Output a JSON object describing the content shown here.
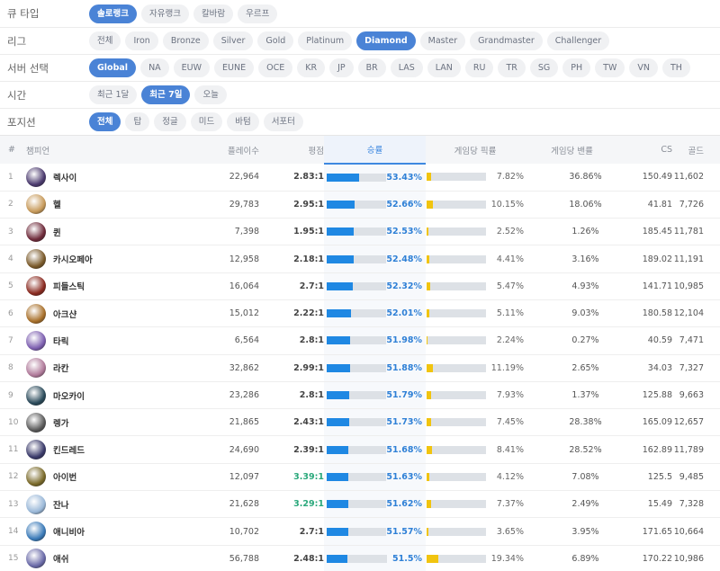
{
  "filters": [
    {
      "label": "큐 타입",
      "options": [
        "솔로랭크",
        "자유랭크",
        "칼바람",
        "우르프"
      ],
      "active": 0
    },
    {
      "label": "리그",
      "options": [
        "전체",
        "Iron",
        "Bronze",
        "Silver",
        "Gold",
        "Platinum",
        "Diamond",
        "Master",
        "Grandmaster",
        "Challenger"
      ],
      "active": 6
    },
    {
      "label": "서버 선택",
      "options": [
        "Global",
        "NA",
        "EUW",
        "EUNE",
        "OCE",
        "KR",
        "JP",
        "BR",
        "LAS",
        "LAN",
        "RU",
        "TR",
        "SG",
        "PH",
        "TW",
        "VN",
        "TH"
      ],
      "active": 0
    },
    {
      "label": "시간",
      "options": [
        "최근 1달",
        "최근 7일",
        "오늘"
      ],
      "active": 1
    },
    {
      "label": "포지션",
      "options": [
        "전체",
        "탑",
        "정글",
        "미드",
        "바텀",
        "서포터"
      ],
      "active": 0
    }
  ],
  "table": {
    "headers": {
      "rank": "#",
      "champion": "챔피언",
      "games": "플레이수",
      "kda": "평점",
      "winrate": "승률",
      "pickrate": "게임당 픽률",
      "banrate": "게임당 밴률",
      "cs": "CS",
      "gold": "골드"
    },
    "rows": [
      {
        "rank": "1",
        "name": "렉사이",
        "games": "22,964",
        "kda": "2.83:1",
        "kda_high": false,
        "winrate": "53.43%",
        "pickrate": "7.82%",
        "banrate": "36.86%",
        "cs": "150.49",
        "gold": "11,602",
        "avatar_color": "#4b3a6e"
      },
      {
        "rank": "2",
        "name": "헬",
        "games": "29,783",
        "kda": "2.95:1",
        "kda_high": false,
        "winrate": "52.66%",
        "pickrate": "10.15%",
        "banrate": "18.06%",
        "cs": "41.81",
        "gold": "7,726",
        "avatar_color": "#c79a5a"
      },
      {
        "rank": "3",
        "name": "퀸",
        "games": "7,398",
        "kda": "1.95:1",
        "kda_high": false,
        "winrate": "52.53%",
        "pickrate": "2.52%",
        "banrate": "1.26%",
        "cs": "185.45",
        "gold": "11,781",
        "avatar_color": "#6e2a3a"
      },
      {
        "rank": "4",
        "name": "카시오페아",
        "games": "12,958",
        "kda": "2.18:1",
        "kda_high": false,
        "winrate": "52.48%",
        "pickrate": "4.41%",
        "banrate": "3.16%",
        "cs": "189.02",
        "gold": "11,191",
        "avatar_color": "#7a5a2a"
      },
      {
        "rank": "5",
        "name": "피들스틱",
        "games": "16,064",
        "kda": "2.7:1",
        "kda_high": false,
        "winrate": "52.32%",
        "pickrate": "5.47%",
        "banrate": "4.93%",
        "cs": "141.71",
        "gold": "10,985",
        "avatar_color": "#8a2a20"
      },
      {
        "rank": "6",
        "name": "아크샨",
        "games": "15,012",
        "kda": "2.22:1",
        "kda_high": false,
        "winrate": "52.01%",
        "pickrate": "5.11%",
        "banrate": "9.03%",
        "cs": "180.58",
        "gold": "12,104",
        "avatar_color": "#a8702a"
      },
      {
        "rank": "7",
        "name": "타릭",
        "games": "6,564",
        "kda": "2.8:1",
        "kda_high": false,
        "winrate": "51.98%",
        "pickrate": "2.24%",
        "banrate": "0.27%",
        "cs": "40.59",
        "gold": "7,471",
        "avatar_color": "#7d5fb0"
      },
      {
        "rank": "8",
        "name": "라칸",
        "games": "32,862",
        "kda": "2.99:1",
        "kda_high": false,
        "winrate": "51.88%",
        "pickrate": "11.19%",
        "banrate": "2.65%",
        "cs": "34.03",
        "gold": "7,327",
        "avatar_color": "#b07a9a"
      },
      {
        "rank": "9",
        "name": "마오카이",
        "games": "23,286",
        "kda": "2.8:1",
        "kda_high": false,
        "winrate": "51.79%",
        "pickrate": "7.93%",
        "banrate": "1.37%",
        "cs": "125.88",
        "gold": "9,663",
        "avatar_color": "#2a4a5a"
      },
      {
        "rank": "10",
        "name": "렝가",
        "games": "21,865",
        "kda": "2.43:1",
        "kda_high": false,
        "winrate": "51.73%",
        "pickrate": "7.45%",
        "banrate": "28.38%",
        "cs": "165.09",
        "gold": "12,657",
        "avatar_color": "#5a5a5a"
      },
      {
        "rank": "11",
        "name": "킨드레드",
        "games": "24,690",
        "kda": "2.39:1",
        "kda_high": false,
        "winrate": "51.68%",
        "pickrate": "8.41%",
        "banrate": "28.52%",
        "cs": "162.89",
        "gold": "11,789",
        "avatar_color": "#3a3a6a"
      },
      {
        "rank": "12",
        "name": "아이번",
        "games": "12,097",
        "kda": "3.39:1",
        "kda_high": true,
        "winrate": "51.63%",
        "pickrate": "4.12%",
        "banrate": "7.08%",
        "cs": "125.5",
        "gold": "9,485",
        "avatar_color": "#7a6a2a"
      },
      {
        "rank": "13",
        "name": "잔나",
        "games": "21,628",
        "kda": "3.29:1",
        "kda_high": true,
        "winrate": "51.62%",
        "pickrate": "7.37%",
        "banrate": "2.49%",
        "cs": "15.49",
        "gold": "7,328",
        "avatar_color": "#9ab8d8"
      },
      {
        "rank": "14",
        "name": "애니비아",
        "games": "10,702",
        "kda": "2.7:1",
        "kda_high": false,
        "winrate": "51.57%",
        "pickrate": "3.65%",
        "banrate": "3.95%",
        "cs": "171.65",
        "gold": "10,664",
        "avatar_color": "#3a7ab8"
      },
      {
        "rank": "15",
        "name": "애쉬",
        "games": "56,788",
        "kda": "2.48:1",
        "kda_high": false,
        "winrate": "51.5%",
        "pickrate": "19.34%",
        "banrate": "6.89%",
        "cs": "170.22",
        "gold": "10,986",
        "avatar_color": "#6a6aa8"
      }
    ]
  },
  "colors": {
    "accent": "#4a83d6",
    "winrate_bar": "#1f88e3",
    "pickrate_bar": "#f1c40f",
    "high_kda": "#2aa87b"
  }
}
